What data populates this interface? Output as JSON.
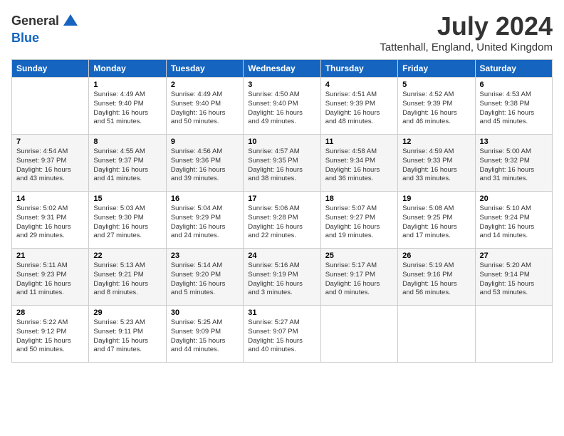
{
  "header": {
    "logo_line1": "General",
    "logo_line2": "Blue",
    "month": "July 2024",
    "location": "Tattenhall, England, United Kingdom"
  },
  "weekdays": [
    "Sunday",
    "Monday",
    "Tuesday",
    "Wednesday",
    "Thursday",
    "Friday",
    "Saturday"
  ],
  "weeks": [
    [
      {
        "day": "",
        "info": ""
      },
      {
        "day": "1",
        "info": "Sunrise: 4:49 AM\nSunset: 9:40 PM\nDaylight: 16 hours\nand 51 minutes."
      },
      {
        "day": "2",
        "info": "Sunrise: 4:49 AM\nSunset: 9:40 PM\nDaylight: 16 hours\nand 50 minutes."
      },
      {
        "day": "3",
        "info": "Sunrise: 4:50 AM\nSunset: 9:40 PM\nDaylight: 16 hours\nand 49 minutes."
      },
      {
        "day": "4",
        "info": "Sunrise: 4:51 AM\nSunset: 9:39 PM\nDaylight: 16 hours\nand 48 minutes."
      },
      {
        "day": "5",
        "info": "Sunrise: 4:52 AM\nSunset: 9:39 PM\nDaylight: 16 hours\nand 46 minutes."
      },
      {
        "day": "6",
        "info": "Sunrise: 4:53 AM\nSunset: 9:38 PM\nDaylight: 16 hours\nand 45 minutes."
      }
    ],
    [
      {
        "day": "7",
        "info": "Sunrise: 4:54 AM\nSunset: 9:37 PM\nDaylight: 16 hours\nand 43 minutes."
      },
      {
        "day": "8",
        "info": "Sunrise: 4:55 AM\nSunset: 9:37 PM\nDaylight: 16 hours\nand 41 minutes."
      },
      {
        "day": "9",
        "info": "Sunrise: 4:56 AM\nSunset: 9:36 PM\nDaylight: 16 hours\nand 39 minutes."
      },
      {
        "day": "10",
        "info": "Sunrise: 4:57 AM\nSunset: 9:35 PM\nDaylight: 16 hours\nand 38 minutes."
      },
      {
        "day": "11",
        "info": "Sunrise: 4:58 AM\nSunset: 9:34 PM\nDaylight: 16 hours\nand 36 minutes."
      },
      {
        "day": "12",
        "info": "Sunrise: 4:59 AM\nSunset: 9:33 PM\nDaylight: 16 hours\nand 33 minutes."
      },
      {
        "day": "13",
        "info": "Sunrise: 5:00 AM\nSunset: 9:32 PM\nDaylight: 16 hours\nand 31 minutes."
      }
    ],
    [
      {
        "day": "14",
        "info": "Sunrise: 5:02 AM\nSunset: 9:31 PM\nDaylight: 16 hours\nand 29 minutes."
      },
      {
        "day": "15",
        "info": "Sunrise: 5:03 AM\nSunset: 9:30 PM\nDaylight: 16 hours\nand 27 minutes."
      },
      {
        "day": "16",
        "info": "Sunrise: 5:04 AM\nSunset: 9:29 PM\nDaylight: 16 hours\nand 24 minutes."
      },
      {
        "day": "17",
        "info": "Sunrise: 5:06 AM\nSunset: 9:28 PM\nDaylight: 16 hours\nand 22 minutes."
      },
      {
        "day": "18",
        "info": "Sunrise: 5:07 AM\nSunset: 9:27 PM\nDaylight: 16 hours\nand 19 minutes."
      },
      {
        "day": "19",
        "info": "Sunrise: 5:08 AM\nSunset: 9:25 PM\nDaylight: 16 hours\nand 17 minutes."
      },
      {
        "day": "20",
        "info": "Sunrise: 5:10 AM\nSunset: 9:24 PM\nDaylight: 16 hours\nand 14 minutes."
      }
    ],
    [
      {
        "day": "21",
        "info": "Sunrise: 5:11 AM\nSunset: 9:23 PM\nDaylight: 16 hours\nand 11 minutes."
      },
      {
        "day": "22",
        "info": "Sunrise: 5:13 AM\nSunset: 9:21 PM\nDaylight: 16 hours\nand 8 minutes."
      },
      {
        "day": "23",
        "info": "Sunrise: 5:14 AM\nSunset: 9:20 PM\nDaylight: 16 hours\nand 5 minutes."
      },
      {
        "day": "24",
        "info": "Sunrise: 5:16 AM\nSunset: 9:19 PM\nDaylight: 16 hours\nand 3 minutes."
      },
      {
        "day": "25",
        "info": "Sunrise: 5:17 AM\nSunset: 9:17 PM\nDaylight: 16 hours\nand 0 minutes."
      },
      {
        "day": "26",
        "info": "Sunrise: 5:19 AM\nSunset: 9:16 PM\nDaylight: 15 hours\nand 56 minutes."
      },
      {
        "day": "27",
        "info": "Sunrise: 5:20 AM\nSunset: 9:14 PM\nDaylight: 15 hours\nand 53 minutes."
      }
    ],
    [
      {
        "day": "28",
        "info": "Sunrise: 5:22 AM\nSunset: 9:12 PM\nDaylight: 15 hours\nand 50 minutes."
      },
      {
        "day": "29",
        "info": "Sunrise: 5:23 AM\nSunset: 9:11 PM\nDaylight: 15 hours\nand 47 minutes."
      },
      {
        "day": "30",
        "info": "Sunrise: 5:25 AM\nSunset: 9:09 PM\nDaylight: 15 hours\nand 44 minutes."
      },
      {
        "day": "31",
        "info": "Sunrise: 5:27 AM\nSunset: 9:07 PM\nDaylight: 15 hours\nand 40 minutes."
      },
      {
        "day": "",
        "info": ""
      },
      {
        "day": "",
        "info": ""
      },
      {
        "day": "",
        "info": ""
      }
    ]
  ]
}
